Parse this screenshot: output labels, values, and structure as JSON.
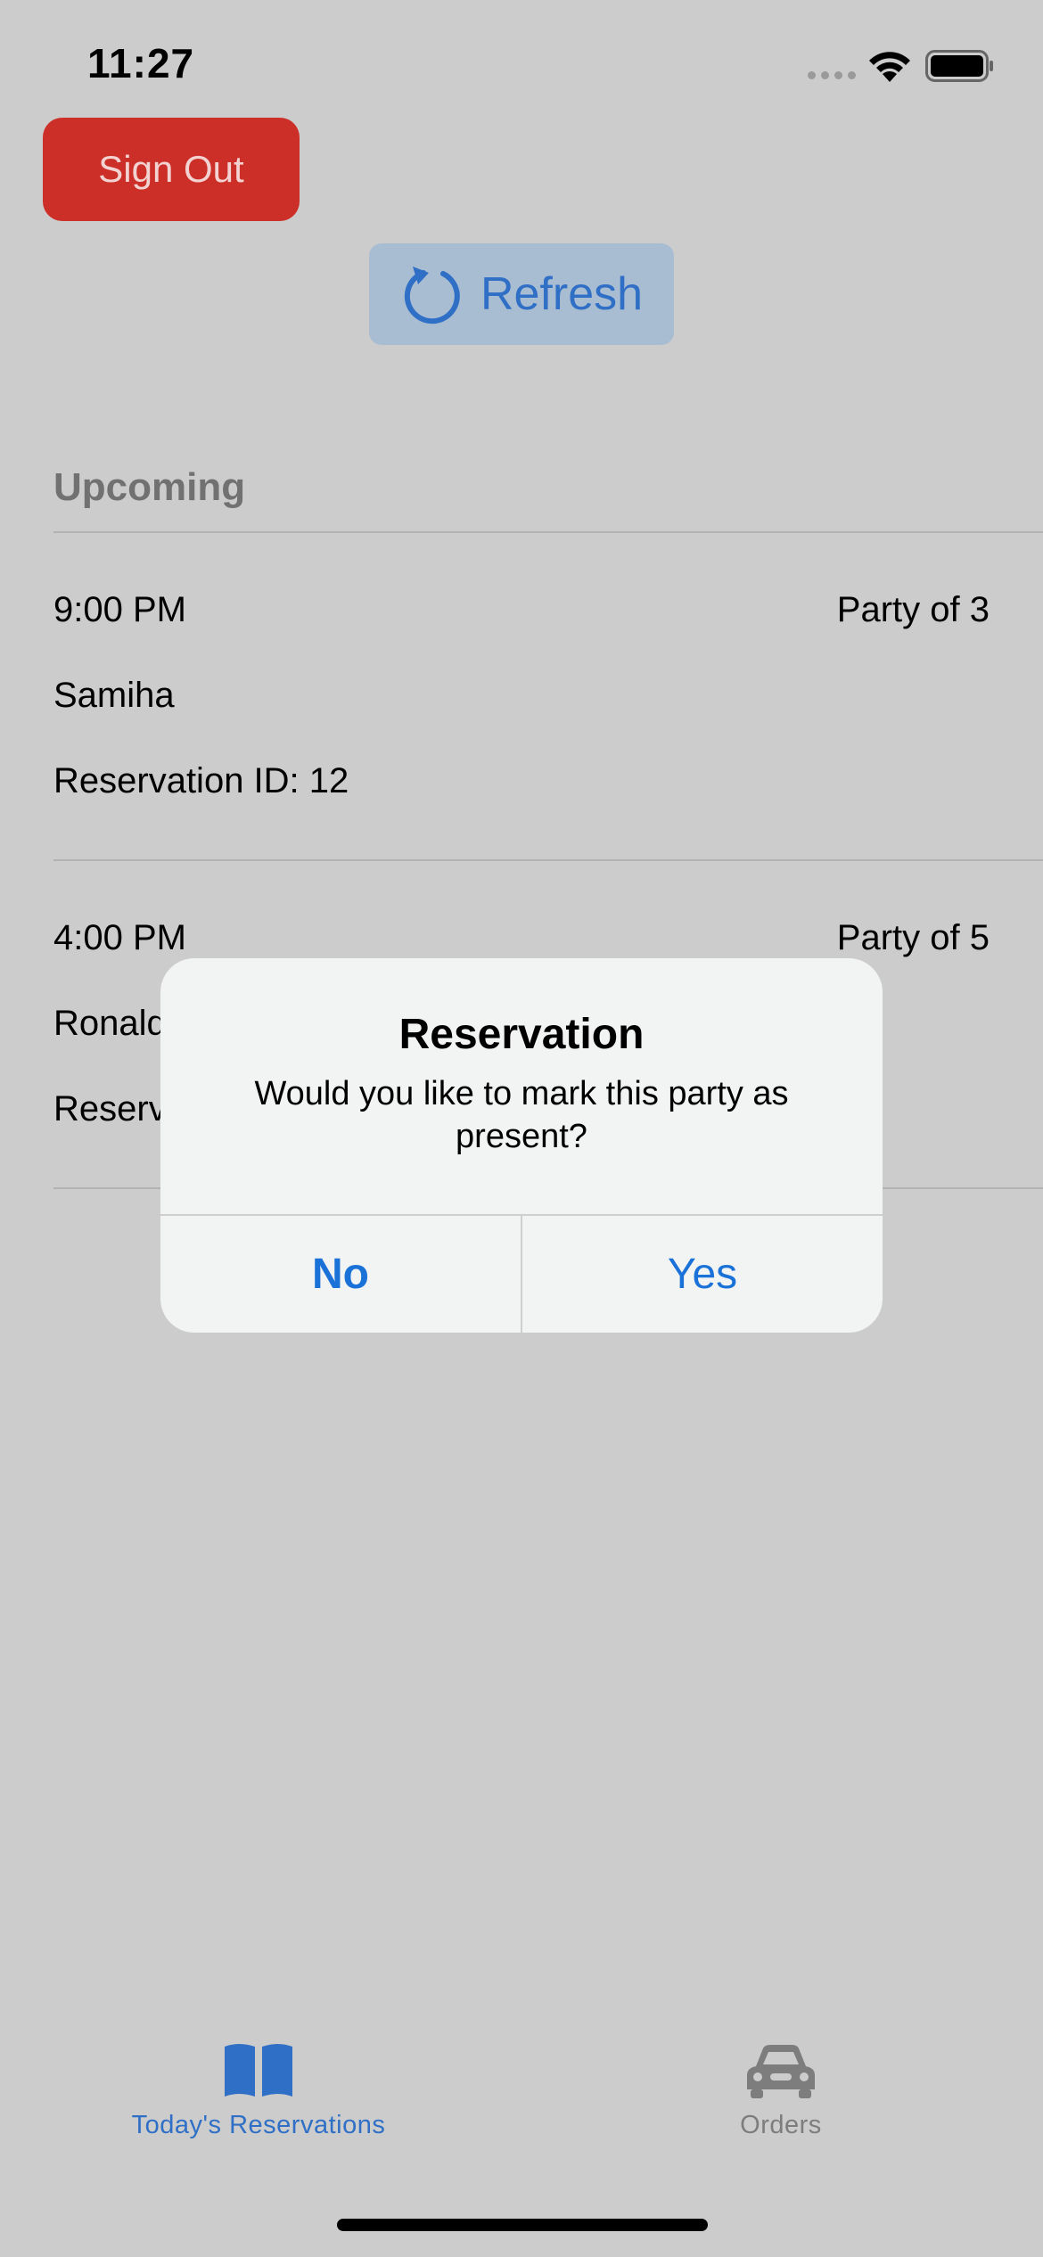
{
  "status_bar": {
    "time": "11:27"
  },
  "header": {
    "sign_out_label": "Sign Out",
    "refresh_label": "Refresh"
  },
  "colors": {
    "sign_out_bg": "#cc2e28",
    "refresh_bg": "#a9bdd2",
    "accent_blue": "#2f6fc6",
    "backdrop": "#cccccc"
  },
  "list": {
    "section_title": "Upcoming",
    "reservations": [
      {
        "time": "9:00 PM",
        "party": "Party of 3",
        "name": "Samiha",
        "reservation_id": "Reservation ID: 12"
      },
      {
        "time": "4:00 PM",
        "party": "Party of 5",
        "name": "Ronald",
        "reservation_id": "Reserv"
      }
    ]
  },
  "alert": {
    "title": "Reservation",
    "message": "Would you like to mark this party as present?",
    "no_label": "No",
    "yes_label": "Yes"
  },
  "tab_bar": {
    "tabs": [
      {
        "label": "Today's Reservations",
        "icon": "book-icon",
        "selected": true
      },
      {
        "label": "Orders",
        "icon": "car-icon",
        "selected": false
      }
    ]
  }
}
